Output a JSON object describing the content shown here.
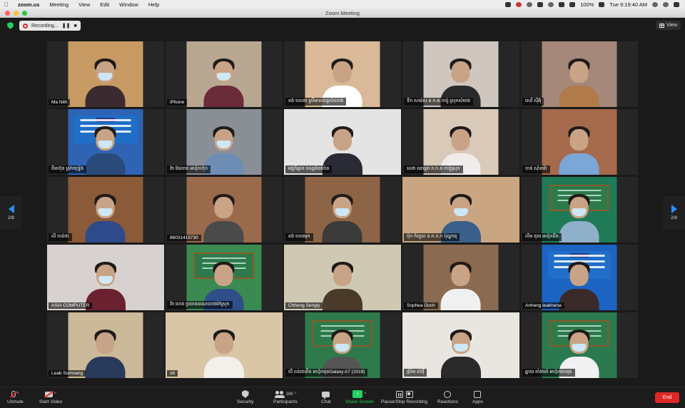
{
  "menubar": {
    "app_name": "zoom.us",
    "items": [
      "Meeting",
      "View",
      "Edit",
      "Window",
      "Help"
    ],
    "battery": "100%",
    "clock": "Tue 9:19:40 AM"
  },
  "window": {
    "title": "Zoom Meeting"
  },
  "recording": {
    "label": "Recording...",
    "pause_glyph": "❚❚",
    "stop_glyph": "■"
  },
  "view_button": {
    "label": "View"
  },
  "pager": {
    "left_label": "2/8",
    "right_label": "2/8"
  },
  "participants": [
    {
      "name": "Ma Nith",
      "bg": "#c89a63",
      "body": "#3b2a30",
      "mask": true,
      "video": "narrow"
    },
    {
      "name": "iPhone",
      "bg": "#b9a891",
      "body": "#6a2b3a",
      "mask": true,
      "video": "narrow"
    },
    {
      "name": "គង់ ចលនា ស្រីមាស់ចន្ទសំណាង",
      "bg": "#d9b998",
      "body": "#ffffff",
      "mask": false,
      "video": "narrow"
    },
    {
      "name": "ទឹក សារ៉េស.ន.ក.ម.កាប៉ូ.ស្រុកសំរោង",
      "bg": "#cfc7bf",
      "body": "#2a2a2a",
      "mask": false,
      "video": "narrow"
    },
    {
      "name": "សេរី ស៊ីអ៊ុំ",
      "bg": "#a5887a",
      "body": "#b07a4a",
      "mask": false,
      "video": "narrow"
    },
    {
      "name": "គីមហ៊ុន ស្រ៊ាយុទ្ធ៉ុង",
      "bg": "#2f64b5",
      "body": "#2a4a7a",
      "mask": true,
      "video": "banner"
    },
    {
      "name": "ង៉ា ផែលាច អាដ៉ុកហ៊ុក",
      "bg": "#8a8f96",
      "body": "#6d8db5",
      "mask": true,
      "video": "narrow"
    },
    {
      "name": "អង្គក៏ឆ្លាត ទស្សតំបន់ចំន",
      "bg": "#e4e4e4",
      "body": "#2a2a35",
      "mask": false,
      "video": "full"
    },
    {
      "name": "សេវា ឈាន្តរា ក.ក.ន កាប៉ូស្រុក",
      "bg": "#d8c9b8",
      "body": "#f1ecec",
      "mask": false,
      "video": "narrow"
    },
    {
      "name": "ចាន់ ស៊ាំធាវ៉ា",
      "bg": "#a56a4b",
      "body": "#7aa7d6",
      "mask": false,
      "video": "narrow"
    },
    {
      "name": "លី ចាន់ថា",
      "bg": "#8b5a38",
      "body": "#2e4a8a",
      "mask": true,
      "video": "narrow"
    },
    {
      "name": "86031419730",
      "bg": "#9a6a4c",
      "body": "#4a4a4a",
      "mask": false,
      "video": "narrow"
    },
    {
      "name": "គង់ ចាលអុក",
      "bg": "#8d6446",
      "body": "#3a3a3a",
      "mask": true,
      "video": "narrow"
    },
    {
      "name": "ប៉ុក ក៏ឃូស ន.ក.ក.ក ប៉ុណ្ឌានុ",
      "bg": "#c9a582",
      "body": "#3a5f8a",
      "mask": true,
      "video": "full"
    },
    {
      "name": "លឹម ឌុយ អាដ៉ុកធឹង",
      "bg": "#1f7a57",
      "body": "#8fb0c9",
      "mask": true,
      "video": "board"
    },
    {
      "name": "ASIA COMPUTER",
      "bg": "#d7d2cf",
      "body": "#6b2230",
      "mask": true,
      "video": "full"
    },
    {
      "name": "ង៉ា ហេព ប្រធានគណេបាឋម៉ៅស្រុក",
      "bg": "#3b8a52",
      "body": "#2f4f8a",
      "mask": false,
      "video": "board"
    },
    {
      "name": "Chheng Sengly",
      "bg": "#cfc9b4",
      "body": "#4a3a2a",
      "mask": false,
      "video": "full"
    },
    {
      "name": "Sophea Ouch",
      "bg": "#8a6a50",
      "body": "#f0f0f0",
      "mask": false,
      "video": "narrow"
    },
    {
      "name": "Anheng leakhena",
      "bg": "#1c63c2",
      "body": "#3a2a2a",
      "mask": false,
      "video": "banner"
    },
    {
      "name": "Leab Somnang",
      "bg": "#cbb99a",
      "body": "#2a3a5a",
      "mask": false,
      "video": "narrow"
    },
    {
      "name": "x8",
      "bg": "#d8c6a6",
      "body": "#f3f0ec",
      "mask": false,
      "video": "full"
    },
    {
      "name": "លី ចន់ដាលីន អាដ៉ុកផុនGalaxy A7 (2018)",
      "bg": "#2f7a4b",
      "body": "#555555",
      "mask": true,
      "video": "board"
    },
    {
      "name": "ប៉ៃ្រម ស៊ាវុី",
      "bg": "#e9e6e2",
      "body": "#2a2a2a",
      "mask": true,
      "video": "full"
    },
    {
      "name": "ឆ្នាយ តាំងាធាំ អាដ៉ុកផកមុន",
      "bg": "#2b7a4f",
      "body": "#f1f1f1",
      "mask": true,
      "video": "board"
    }
  ],
  "toolbar": {
    "unmute": "Unmute",
    "start_video": "Start Video",
    "security": "Security",
    "participants": "Participants",
    "participants_count": "188",
    "chat": "Chat",
    "share_screen": "Share Screen",
    "share_glyph": "↑",
    "pause_stop": "Pause/Stop Recording",
    "reactions": "Reactions",
    "apps": "Apps",
    "end": "End",
    "caret": "^"
  },
  "colors": {
    "accent_blue": "#2d8cff",
    "share_green": "#23d160",
    "end_red": "#e02828"
  }
}
